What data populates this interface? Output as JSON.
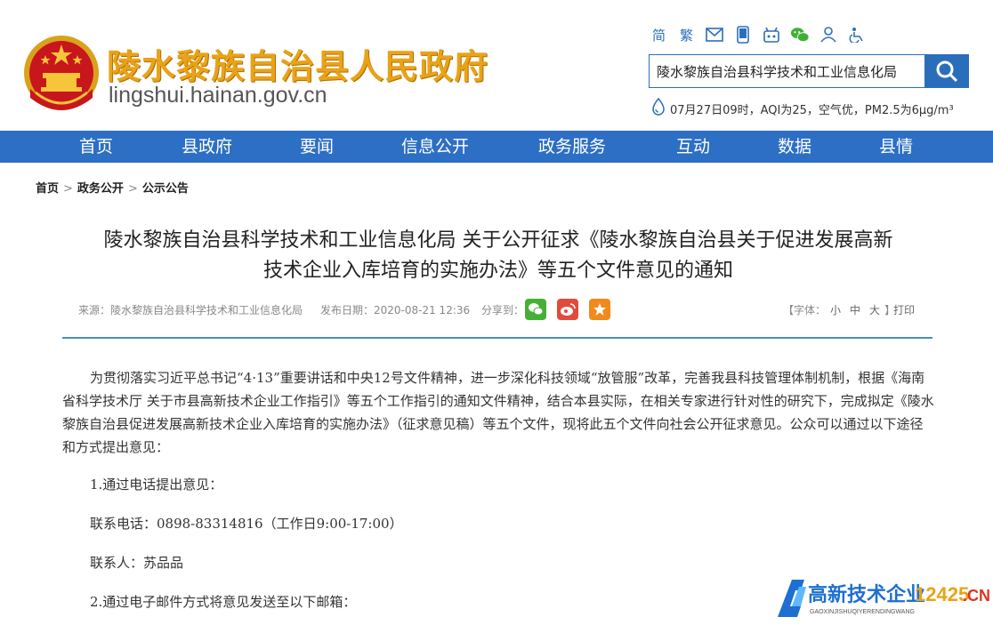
{
  "site": {
    "title": "陵水黎族自治县人民政府",
    "domain": "lingshui.hainan.gov.cn"
  },
  "toolbar": {
    "simplified": "简",
    "traditional": "繁"
  },
  "search": {
    "value": "陵水黎族自治县科学技术和工业信息化局"
  },
  "weather": {
    "text": "07月27日09时，AQI为25，空气优，PM2.5为6μg/m³"
  },
  "nav": {
    "items": [
      "首页",
      "县政府",
      "要闻",
      "信息公开",
      "政务服务",
      "互动",
      "数据",
      "县情"
    ]
  },
  "breadcrumb": {
    "items": [
      "首页",
      "政务公开",
      "公示公告"
    ],
    "separator": ">"
  },
  "article": {
    "title_line1": "陵水黎族自治县科学技术和工业信息化局 关于公开征求《陵水黎族自治县关于促进发展高新",
    "title_line2": "技术企业入库培育的实施办法》等五个文件意见的通知",
    "source": "来源：陵水黎族自治县科学技术和工业信息化局",
    "date": "发布日期：2020-08-21 12:36",
    "share_label": "分享到：",
    "font_label_open": "【字体：",
    "font_small": "小",
    "font_medium": "中",
    "font_large": "大",
    "font_label_close": "】",
    "print": "打印",
    "paragraph1": "为贯彻落实习近平总书记“4·13”重要讲话和中央12号文件精神，进一步深化科技领域“放管服”改革，完善我县科技管理体制机制，根据《海南省科学技术厅 关于市县高新技术企业工作指引》等五个工作指引的通知文件精神，结合本县实际，在相关专家进行针对性的研究下，完成拟定《陵水黎族自治县促进发展高新技术企业入库培育的实施办法》（征求意见稿）等五个文件，现将此五个文件向社会公开征求意见。公众可以通过以下途径和方式提出意见：",
    "item1": "1.通过电话提出意见：",
    "phone": "联系电话：0898-83314816（工作日9:00-17:00）",
    "contact": "联系人：苏品品",
    "item2": "2.通过电子邮件方式将意见发送至以下邮箱："
  },
  "watermark": {
    "text": "高新技术企业",
    "sub": "GAOXINJISHUQIYERENDINGWANG",
    "number": "12425",
    "tld": ".CN"
  },
  "colors": {
    "nav_bg": "#2d6fc4",
    "title_gold": "#e8a317",
    "accent_blue": "#2a6ebb",
    "rule": "#4b8fb8"
  }
}
